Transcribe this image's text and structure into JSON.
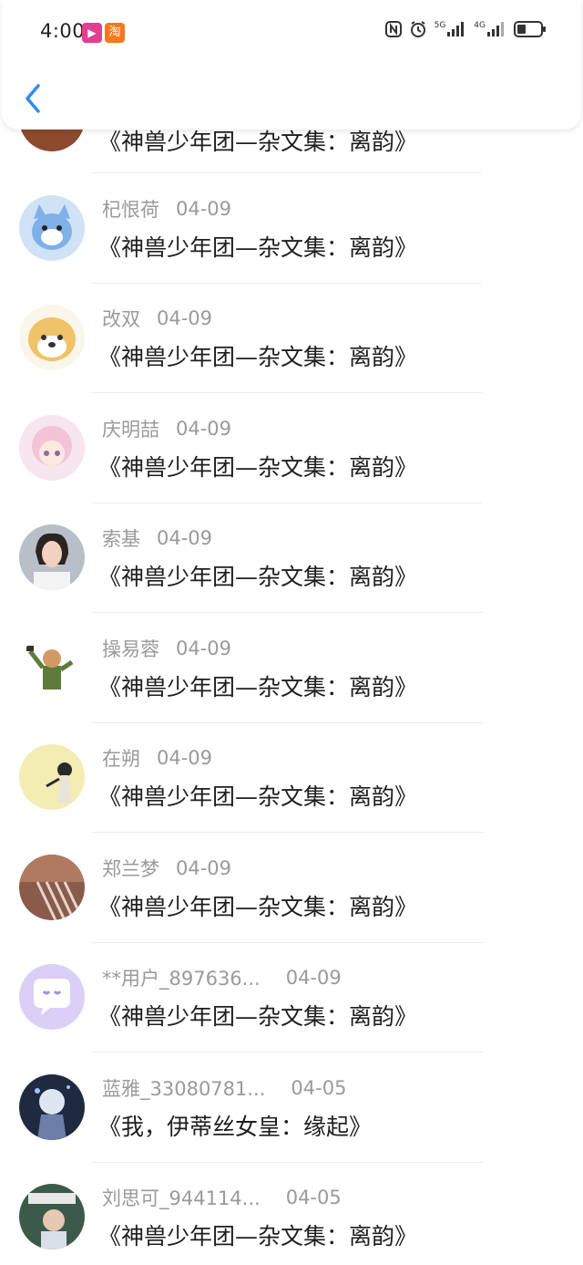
{
  "status_bar": {
    "time": "4:00",
    "badge_video_glyph": "▶",
    "badge_taobao_glyph": "淘",
    "network_label_1": "5G",
    "network_label_2": "4G"
  },
  "header": {
    "back_icon": "chevron-left-icon"
  },
  "partial_top_title": "《神兽少年团—杂文集：离韵》",
  "items": [
    {
      "name": "杞恨荷",
      "date": "04-09",
      "title": "《神兽少年团—杂文集：离韵》",
      "avatar": "cartoon-cat"
    },
    {
      "name": "改双",
      "date": "04-09",
      "title": "《神兽少年团—杂文集：离韵》",
      "avatar": "shiba-dog"
    },
    {
      "name": "庆明喆",
      "date": "04-09",
      "title": "《神兽少年团—杂文集：离韵》",
      "avatar": "anime-girl"
    },
    {
      "name": "索基",
      "date": "04-09",
      "title": "《神兽少年团—杂文集：离韵》",
      "avatar": "woman-photo"
    },
    {
      "name": "操易蓉",
      "date": "04-09",
      "title": "《神兽少年团—杂文集：离韵》",
      "avatar": "cartoon-character"
    },
    {
      "name": "在朔",
      "date": "04-09",
      "title": "《神兽少年团—杂文集：离韵》",
      "avatar": "girl-yellow"
    },
    {
      "name": "郑兰梦",
      "date": "04-09",
      "title": "《神兽少年团—杂文集：离韵》",
      "avatar": "piano-photo"
    },
    {
      "name": "**用户_897636...",
      "date": "04-09",
      "title": "《神兽少年团—杂文集：离韵》",
      "avatar": "default-chat"
    },
    {
      "name": "蓝雅_33080781...",
      "date": "04-05",
      "title": "《我，伊蒂丝女皇：缘起》",
      "avatar": "dark-anime"
    },
    {
      "name": "刘思可_944114...",
      "date": "04-05",
      "title": "《神兽少年团—杂文集：离韵》",
      "avatar": "magazine-photo"
    }
  ],
  "colors": {
    "accent_blue": "#2f8cf0",
    "meta_gray": "#9a9a9a",
    "title_text": "#1e1e1e",
    "default_avatar_bg": "#d9cff7"
  }
}
